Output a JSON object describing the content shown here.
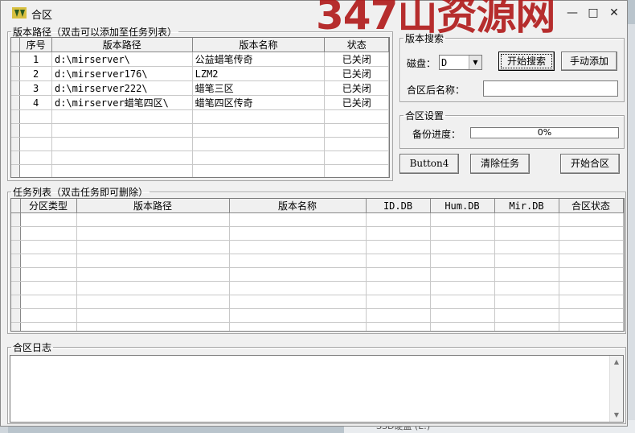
{
  "window": {
    "title": "合区",
    "watermark": "347山资源网",
    "controls": {
      "minimize": "—",
      "maximize": "□",
      "close": "✕"
    }
  },
  "version_paths": {
    "legend": "版本路径（双击可以添加至任务列表）",
    "columns": [
      "序号",
      "版本路径",
      "版本名称",
      "状态"
    ],
    "rows": [
      {
        "no": "1",
        "path": "d:\\mirserver\\",
        "name": "公益蜡笔传奇",
        "status": "已关闭"
      },
      {
        "no": "2",
        "path": "d:\\mirserver176\\",
        "name": "LZM2",
        "status": "已关闭"
      },
      {
        "no": "3",
        "path": "d:\\mirserver222\\",
        "name": "蜡笔三区",
        "status": "已关闭"
      },
      {
        "no": "4",
        "path": "d:\\mirserver蜡笔四区\\",
        "name": "蜡笔四区传奇",
        "status": "已关闭"
      }
    ]
  },
  "version_search": {
    "legend": "版本搜索",
    "disk_label": "磁盘：",
    "disk_value": "D",
    "start_search_button": "开始搜索",
    "manual_add_button": "手动添加",
    "merge_name_label": "合区后名称：",
    "merge_name_value": ""
  },
  "merge_settings": {
    "legend": "合区设置",
    "backup_progress_label": "备份进度：",
    "backup_progress_text": "0%",
    "backup_progress_value": 0
  },
  "actions": {
    "button4": "Button4",
    "clear_tasks": "清除任务",
    "start_merge": "开始合区"
  },
  "task_list": {
    "legend": "任务列表（双击任务即可删除）",
    "columns": [
      "分区类型",
      "版本路径",
      "版本名称",
      "ID.DB",
      "Hum.DB",
      "Mir.DB",
      "合区状态"
    ]
  },
  "merge_log": {
    "legend": "合区日志",
    "content": ""
  },
  "background": {
    "drive_label": "SSD硬盘 (E:)"
  }
}
